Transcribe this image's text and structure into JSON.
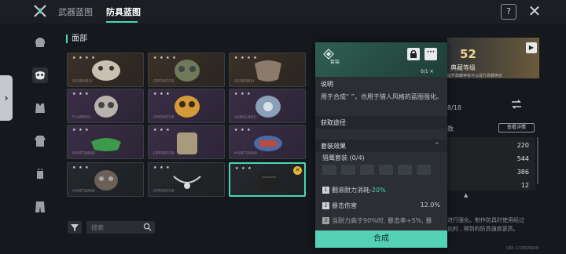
{
  "colors": {
    "accent": "#4ad6b4",
    "gold": "#e0b838",
    "background": "#15181c"
  },
  "header": {
    "tabs": [
      {
        "label": "武器蓝图",
        "active": false
      },
      {
        "label": "防具蓝图",
        "active": true
      }
    ],
    "help_label": "?",
    "close_icon": "close-icon"
  },
  "sidebar": {
    "items": [
      {
        "icon": "head-icon",
        "active": false
      },
      {
        "icon": "mask-icon",
        "active": true
      },
      {
        "icon": "vest-icon",
        "active": false
      },
      {
        "icon": "jacket-icon",
        "active": false
      },
      {
        "icon": "glove-icon",
        "active": false
      },
      {
        "icon": "pants-icon",
        "active": false
      }
    ]
  },
  "grid": {
    "title": "面部",
    "cards": [
      {
        "brand": "ASSEMBLY",
        "stars": "★ ★ ★ ★",
        "style": "brown"
      },
      {
        "brand": "OPERATOR",
        "stars": "★ ★ ★ ★",
        "style": "brown"
      },
      {
        "brand": "ASSEMBLY",
        "stars": "★ ★ ★ ★",
        "style": "brown"
      },
      {
        "brand": "FLAMERS",
        "stars": "★ ★ ★",
        "style": "purple"
      },
      {
        "brand": "OPERATOR",
        "stars": "★ ★ ★",
        "style": "purple"
      },
      {
        "brand": "VANGUARD",
        "stars": "★ ★ ★",
        "style": "purple"
      },
      {
        "brand": "HUNTSMAN",
        "stars": "★ ★ ★",
        "style": "purple"
      },
      {
        "brand": "OPERATOR",
        "stars": "★ ★ ★",
        "style": "purple"
      },
      {
        "brand": "HUNTSMAN",
        "stars": "★ ★ ★",
        "style": "purple"
      },
      {
        "brand": "HUNTSMAN",
        "stars": "★ ★ ★",
        "style": "dark"
      },
      {
        "brand": "OPERATOR",
        "stars": "★ ★ ★",
        "style": "dark"
      },
      {
        "brand": "",
        "stars": "★ ★ ★",
        "style": "dark",
        "selected": true
      }
    ],
    "search": {
      "placeholder": "搜索",
      "value": ""
    }
  },
  "popup": {
    "set_label": "套装",
    "count": "0/1",
    "desc_label": "说明",
    "desc_text": "用于合成“ ”，也用于猎人风格的蓝图强化。",
    "source_label": "获取途径",
    "set_effect_label": "套装效果",
    "set_name": "猎鹰套装 (0/4)",
    "bonuses": [
      {
        "num": "1",
        "label": "翻滚耐力消耗-",
        "value": "20%",
        "highlight": true
      },
      {
        "num": "2",
        "label": "暴击伤害",
        "value": "12.0%",
        "highlight": false
      },
      {
        "num": "3",
        "label": "当耐力高于90%时, 暴击率+5%, 暴",
        "value": "",
        "highlight": false
      }
    ],
    "craft_label": "合成"
  },
  "right": {
    "level_num": "52",
    "level_label": "典藏等级",
    "level_sub": "提升典藏等级可以提升典藏等级",
    "fraction": "8/18",
    "shu_label": "数",
    "detail_btn": "查看详情",
    "stats": [
      "220",
      "544",
      "386",
      "12"
    ],
    "desc": "可进行强化, 制作防具时使用经过强化的, 得到的防具强度更高。",
    "desc_lead": "图进行强化。制作防具时使用经过",
    "desc_lead2": "强化的       , 得到的防具强度更高。",
    "uid": "UID: 172925040"
  }
}
